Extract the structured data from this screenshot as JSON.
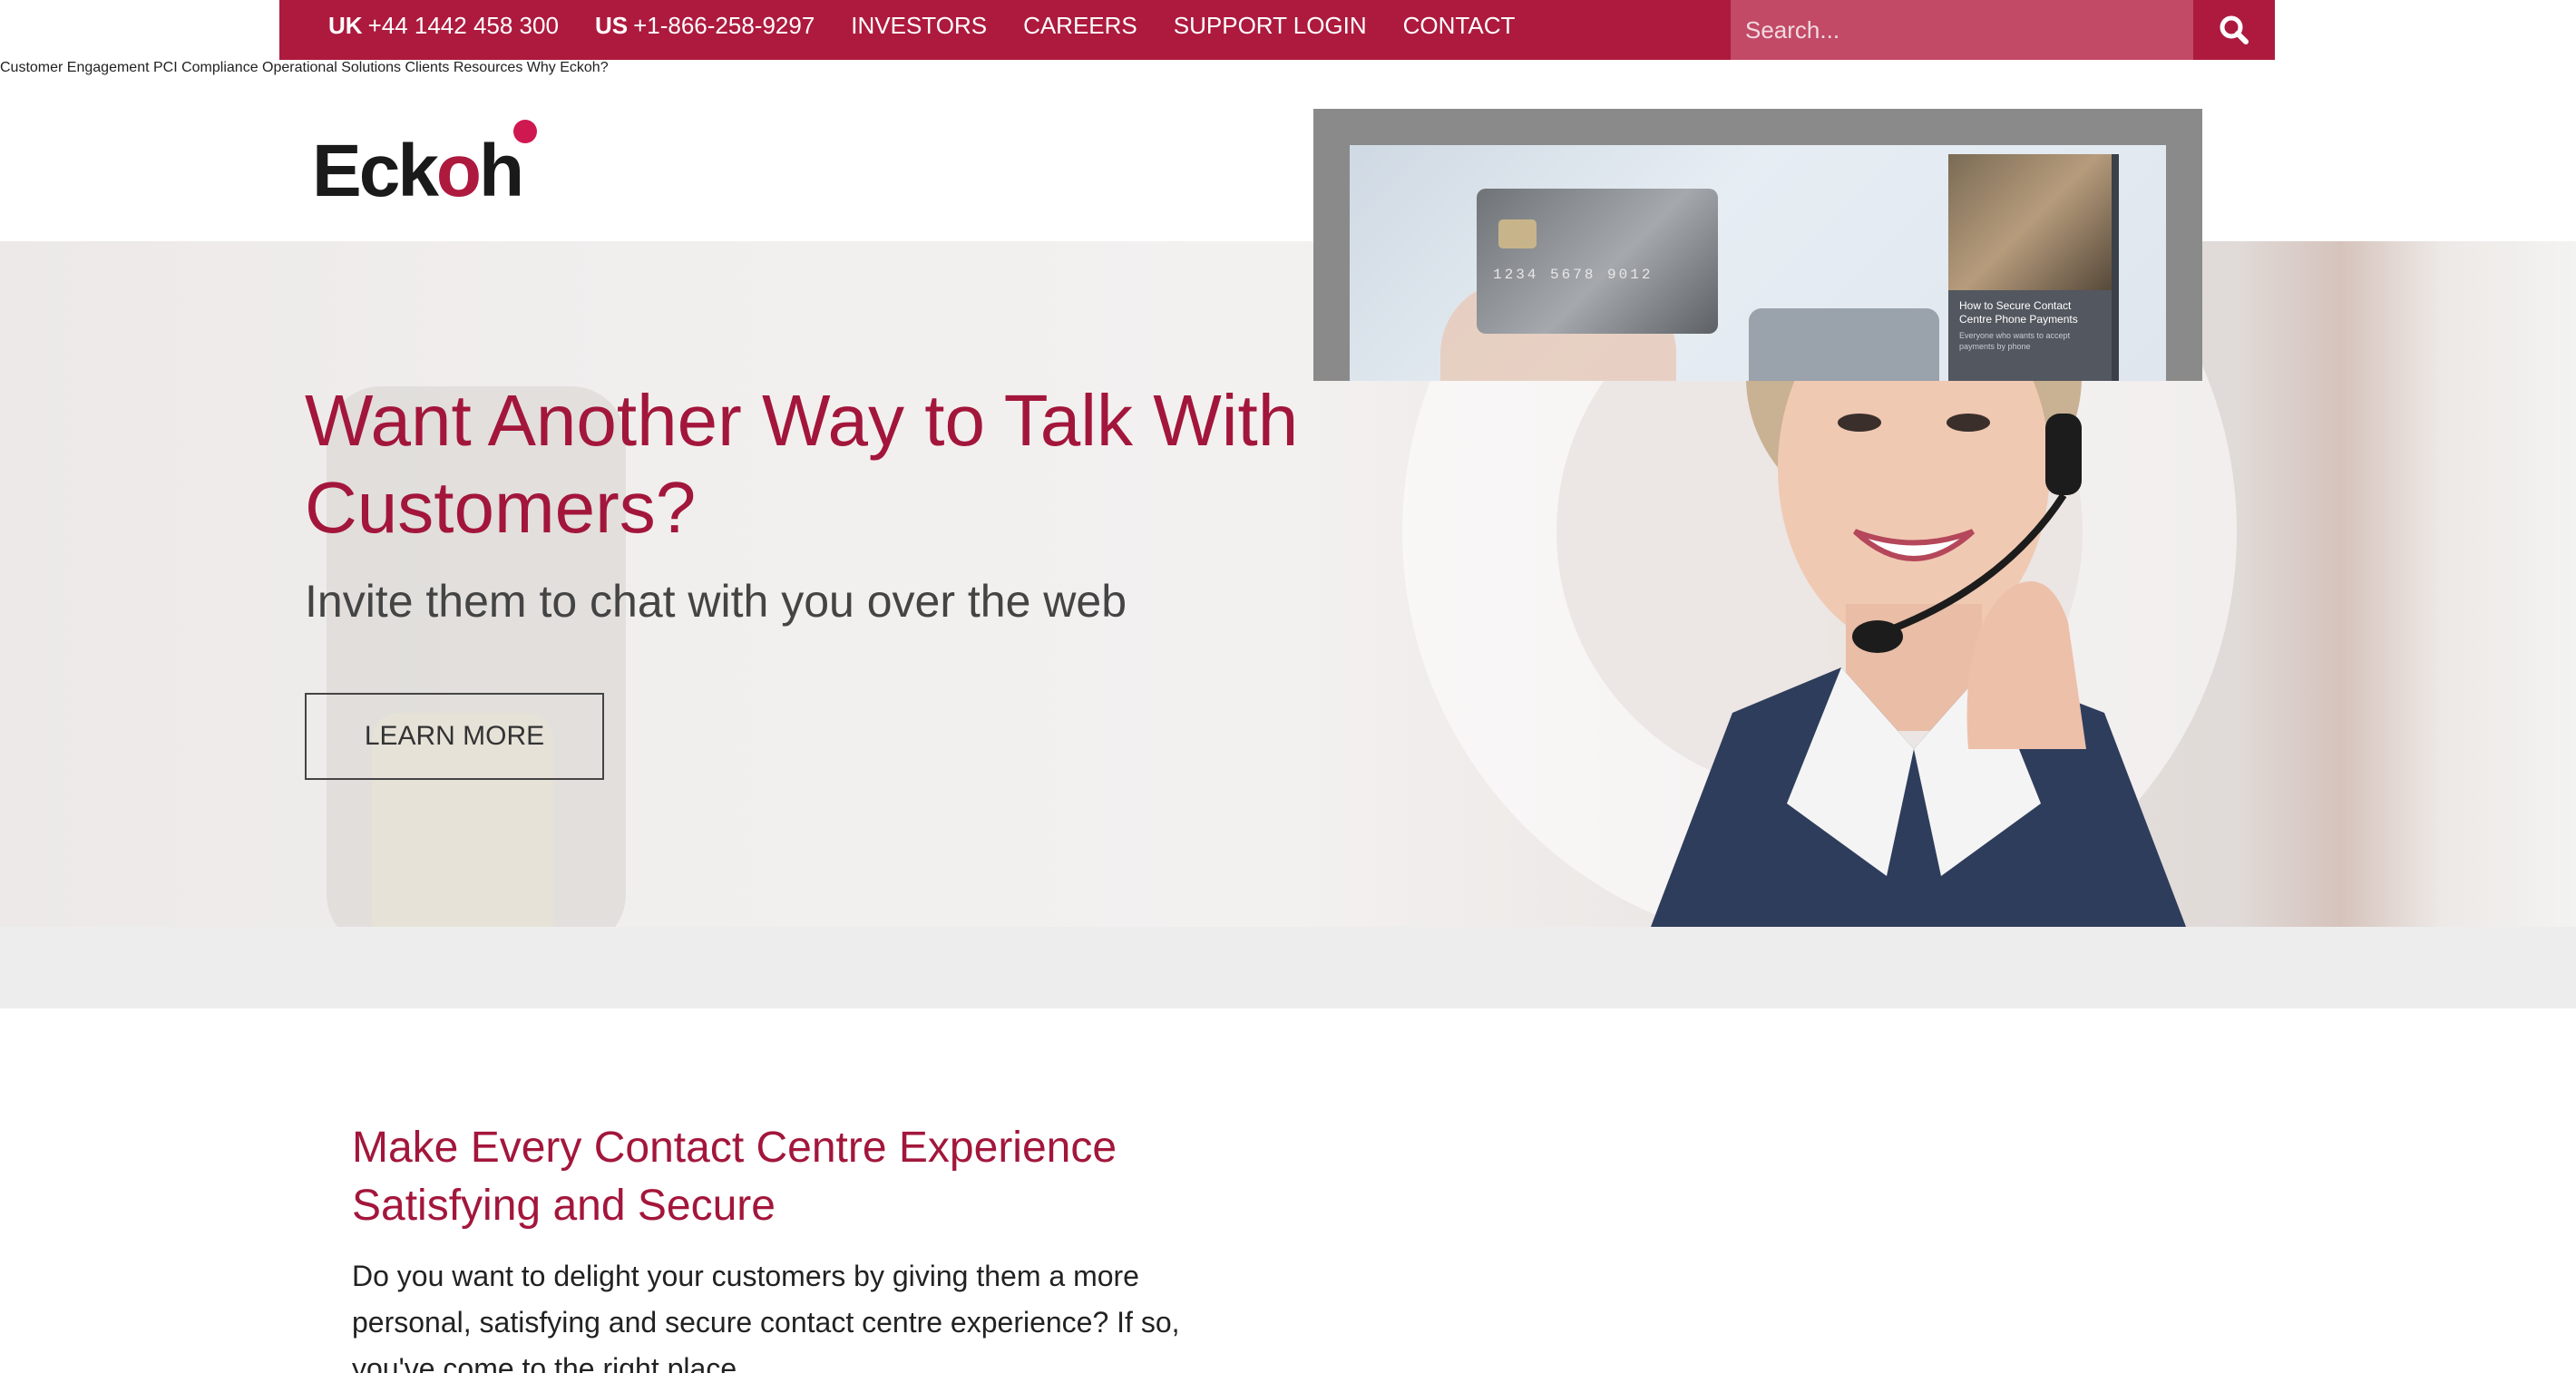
{
  "topbar": {
    "uk_label": "UK",
    "uk_phone": "+44 1442 458 300",
    "us_label": "US",
    "us_phone": "+1-866-258-9297",
    "links": [
      "INVESTORS",
      "CAREERS",
      "SUPPORT LOGIN",
      "CONTACT"
    ],
    "search_placeholder": "Search...",
    "search_icon": "search-icon",
    "bg_color": "#ad1a3e"
  },
  "header": {
    "logo_text_before": "Ec",
    "logo_text_accent": "k",
    "logo_text_o": "o",
    "logo_text_after": "h",
    "nav": [
      "Customer Engagement",
      "PCI Compliance",
      "Operational Solutions",
      "Clients",
      "Resources",
      "Why Eckoh?"
    ]
  },
  "hero": {
    "title": "Want Another Way to Talk With Customers?",
    "subtitle": "Invite them to chat with you over the web",
    "button_label": "LEARN MORE",
    "accent_color": "#a3163b"
  },
  "content": {
    "heading": "Make Every Contact Centre Experience Satisfying and Secure",
    "paragraph": "Do you want to delight your customers by giving them a more personal, satisfying and secure contact centre experience? If so, you've come to the right place.",
    "card_number": "1234  5678  9012",
    "book_title": "How to Secure Contact Centre Phone Payments",
    "book_body": "Everyone who wants to accept payments by phone"
  }
}
